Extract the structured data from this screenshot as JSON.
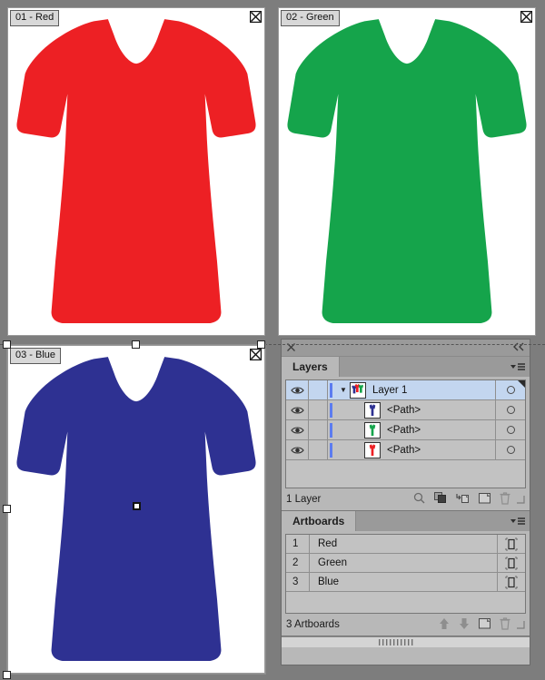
{
  "app": {
    "canvas_bg": "#7d7d7d",
    "panel_bg": "#b8b8b8"
  },
  "colors": {
    "red": "#ED2024",
    "green": "#15A44B",
    "blue": "#2E3192",
    "selection_blue": "#5c7cf0",
    "row_selected": "#c3d6ef"
  },
  "artboards_canvas": [
    {
      "label": "01 - Red",
      "color": "#ED2024",
      "selected": false
    },
    {
      "label": "02 - Green",
      "color": "#15A44B",
      "selected": false
    },
    {
      "label": "03 - Blue",
      "color": "#2E3192",
      "selected": true
    }
  ],
  "dock": {
    "close_icon": "close-icon",
    "collapse_icon": "double-chevron-left-icon"
  },
  "layers_panel": {
    "tab_label": "Layers",
    "menu_icon": "panel-menu-icon",
    "rows": [
      {
        "name": "Layer 1",
        "kind": "layer",
        "selected": true,
        "visible": true,
        "expanded": true,
        "thumb": "all"
      },
      {
        "name": "<Path>",
        "kind": "object",
        "selected": false,
        "visible": true,
        "expanded": false,
        "thumb": "blue"
      },
      {
        "name": "<Path>",
        "kind": "object",
        "selected": false,
        "visible": true,
        "expanded": false,
        "thumb": "green"
      },
      {
        "name": "<Path>",
        "kind": "object",
        "selected": false,
        "visible": true,
        "expanded": false,
        "thumb": "red"
      }
    ],
    "footer": {
      "count": "1 Layer",
      "icons": [
        "locate-object-icon",
        "make-clipping-mask-icon",
        "create-new-sublayer-icon",
        "create-new-layer-icon",
        "delete-selection-icon"
      ]
    }
  },
  "artboards_panel": {
    "tab_label": "Artboards",
    "menu_icon": "panel-menu-icon",
    "rows": [
      {
        "num": "1",
        "name": "Red"
      },
      {
        "num": "2",
        "name": "Green"
      },
      {
        "num": "3",
        "name": "Blue"
      }
    ],
    "footer": {
      "count": "3 Artboards",
      "icons": [
        "move-up-icon",
        "move-down-icon",
        "new-artboard-icon",
        "delete-artboard-icon"
      ]
    }
  }
}
